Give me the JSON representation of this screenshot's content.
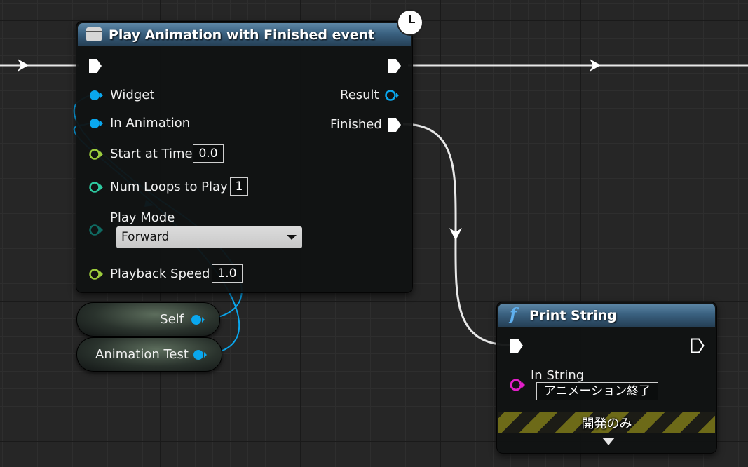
{
  "play_node": {
    "title": "Play Animation with Finished event",
    "inputs": {
      "widget": "Widget",
      "in_animation": "In Animation",
      "start_at_time": "Start at Time",
      "start_at_time_value": "0.0",
      "num_loops": "Num Loops to Play",
      "num_loops_value": "1",
      "play_mode": "Play Mode",
      "play_mode_value": "Forward",
      "playback_speed": "Playback Speed",
      "playback_speed_value": "1.0"
    },
    "outputs": {
      "result": "Result",
      "finished": "Finished"
    }
  },
  "variables": {
    "self": "Self",
    "animation_test": "Animation Test"
  },
  "print_node": {
    "title": "Print String",
    "in_string_label": "In String",
    "in_string_value": "アニメーション終了",
    "dev_only": "開発のみ"
  },
  "colors": {
    "object_pin": "#0aa7ee",
    "float_pin": "#9ccc3c",
    "int_pin": "#2ec9a0",
    "byte_pin": "#0f6b63",
    "string_pin": "#e21ec8",
    "exec": "#ffffff",
    "header": "#3a6180"
  }
}
